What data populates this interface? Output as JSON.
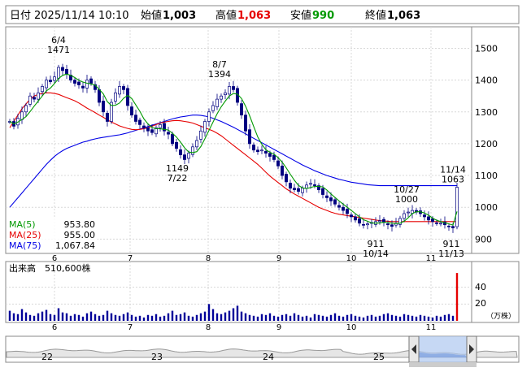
{
  "header": {
    "date_label": "日付",
    "datetime": "2025/11/14 10:10",
    "open_label": "始値",
    "open_value": "1,003",
    "high_label": "高値",
    "high_value": "1,063",
    "low_label": "安値",
    "low_value": "990",
    "close_label": "終値",
    "close_value": "1,063"
  },
  "colors": {
    "high": "#e60000",
    "low": "#009900",
    "ma5": "#009900",
    "ma25": "#e60000",
    "ma75": "#0000e6",
    "up_candle": "#ffffff",
    "down_candle": "#00007f",
    "volume": "#000099",
    "volume_last": "#e60000",
    "navigator_fill": "#aec8f0"
  },
  "legend": [
    {
      "label": "MA(5)",
      "value": "953.80",
      "color": "#009900"
    },
    {
      "label": "MA(25)",
      "value": "955.00",
      "color": "#e60000"
    },
    {
      "label": "MA(75)",
      "value": "1,067.84",
      "color": "#0000e6"
    }
  ],
  "volume_panel": {
    "title": "出来高",
    "value": "510,600株",
    "unit": "（万株）",
    "ticks": [
      "40",
      "20"
    ]
  },
  "navigator": {
    "labels": [
      "22",
      "23",
      "24",
      "25"
    ]
  },
  "chart_data": {
    "type": "candlestick",
    "y_range": [
      860,
      1560
    ],
    "y_ticks": [
      900,
      1000,
      1100,
      1200,
      1300,
      1400,
      1500
    ],
    "x_ticks": [
      "6",
      "7",
      "8",
      "9",
      "10",
      "11"
    ],
    "annotations": [
      {
        "date": "6/4",
        "value": 1471,
        "position": "above"
      },
      {
        "date": "8/7",
        "value": 1394,
        "position": "above"
      },
      {
        "date": "7/22",
        "value": 1149,
        "position": "below"
      },
      {
        "date": "10/27",
        "value": 1000,
        "position": "above"
      },
      {
        "date": "10/14",
        "value": 911,
        "position": "below"
      },
      {
        "date": "11/14",
        "value": 1063,
        "position": "above"
      },
      {
        "date": "11/13",
        "value": 911,
        "position": "below"
      }
    ],
    "close_series": [
      1270,
      1255,
      1280,
      1300,
      1320,
      1350,
      1340,
      1360,
      1380,
      1400,
      1395,
      1410,
      1440,
      1430,
      1420,
      1400,
      1390,
      1385,
      1375,
      1400,
      1390,
      1370,
      1330,
      1300,
      1270,
      1330,
      1360,
      1380,
      1370,
      1320,
      1290,
      1270,
      1260,
      1250,
      1240,
      1235,
      1250,
      1260,
      1240,
      1230,
      1200,
      1185,
      1165,
      1150,
      1170,
      1190,
      1210,
      1240,
      1270,
      1300,
      1320,
      1340,
      1350,
      1360,
      1380,
      1370,
      1330,
      1290,
      1240,
      1200,
      1180,
      1175,
      1180,
      1170,
      1160,
      1150,
      1130,
      1100,
      1080,
      1060,
      1055,
      1050,
      1060,
      1070,
      1075,
      1068,
      1055,
      1040,
      1030,
      1020,
      1010,
      1000,
      990,
      980,
      970,
      960,
      950,
      945,
      948,
      950,
      955,
      958,
      952,
      945,
      940,
      950,
      965,
      980,
      985,
      990,
      985,
      980,
      970,
      960,
      955,
      950,
      950,
      945,
      940,
      935,
      1063
    ],
    "ma5_series": [
      1270,
      1262,
      1268,
      1276,
      1285,
      1301,
      1318,
      1334,
      1350,
      1366,
      1375,
      1389,
      1405,
      1415,
      1419,
      1415,
      1408,
      1399,
      1394,
      1390,
      1388,
      1384,
      1371,
      1357,
      1332,
      1320,
      1321,
      1328,
      1343,
      1352,
      1342,
      1322,
      1302,
      1278,
      1262,
      1251,
      1247,
      1247,
      1245,
      1243,
      1233,
      1221,
      1205,
      1187,
      1174,
      1172,
      1175,
      1191,
      1216,
      1242,
      1268,
      1294,
      1316,
      1334,
      1350,
      1358,
      1356,
      1342,
      1318,
      1288,
      1254,
      1221,
      1198,
      1181,
      1173,
      1167,
      1156,
      1142,
      1124,
      1104,
      1085,
      1069,
      1061,
      1059,
      1062,
      1066,
      1066,
      1064,
      1054,
      1042,
      1031,
      1020,
      1010,
      1000,
      990,
      980,
      970,
      961,
      956,
      951,
      950,
      951,
      953,
      952,
      950,
      949,
      950,
      956,
      967,
      980,
      986,
      986,
      982,
      975,
      966,
      959,
      955,
      951,
      948,
      944,
      987
    ],
    "ma25_series": [
      1250,
      1270,
      1290,
      1310,
      1325,
      1340,
      1350,
      1355,
      1358,
      1360,
      1360,
      1358,
      1355,
      1350,
      1345,
      1340,
      1335,
      1328,
      1320,
      1312,
      1305,
      1298,
      1290,
      1283,
      1275,
      1268,
      1262,
      1256,
      1252,
      1248,
      1245,
      1244,
      1245,
      1247,
      1250,
      1255,
      1260,
      1265,
      1268,
      1270,
      1272,
      1273,
      1272,
      1270,
      1268,
      1265,
      1260,
      1255,
      1250,
      1245,
      1240,
      1233,
      1225,
      1215,
      1205,
      1195,
      1185,
      1175,
      1165,
      1155,
      1145,
      1135,
      1123,
      1110,
      1098,
      1088,
      1078,
      1068,
      1058,
      1050,
      1042,
      1035,
      1028,
      1021,
      1014,
      1007,
      1000,
      995,
      990,
      985,
      981,
      978,
      976,
      974,
      972,
      970,
      968,
      966,
      964,
      962,
      960,
      958,
      957,
      956,
      955,
      955,
      955,
      955,
      955,
      955,
      955,
      955,
      955,
      955,
      955,
      955,
      955,
      955,
      955,
      955,
      955
    ],
    "ma75_series": [
      1000,
      1015,
      1030,
      1045,
      1060,
      1075,
      1090,
      1105,
      1120,
      1135,
      1148,
      1160,
      1170,
      1178,
      1185,
      1190,
      1195,
      1200,
      1205,
      1208,
      1212,
      1215,
      1218,
      1220,
      1222,
      1224,
      1226,
      1228,
      1231,
      1234,
      1238,
      1242,
      1246,
      1250,
      1254,
      1258,
      1262,
      1266,
      1270,
      1274,
      1278,
      1281,
      1284,
      1286,
      1288,
      1290,
      1290,
      1289,
      1287,
      1284,
      1280,
      1275,
      1270,
      1264,
      1258,
      1252,
      1245,
      1238,
      1231,
      1224,
      1217,
      1210,
      1203,
      1196,
      1189,
      1182,
      1175,
      1168,
      1161,
      1154,
      1147,
      1140,
      1133,
      1127,
      1121,
      1115,
      1110,
      1105,
      1100,
      1096,
      1092,
      1088,
      1085,
      1082,
      1079,
      1077,
      1075,
      1073,
      1071,
      1070,
      1069,
      1068,
      1068,
      1068,
      1068,
      1068,
      1068,
      1068,
      1068,
      1068,
      1068,
      1068,
      1068,
      1068,
      1068,
      1068,
      1068,
      1068,
      1068,
      1068,
      1068
    ],
    "volume_series": [
      12,
      9,
      8,
      14,
      10,
      7,
      6,
      9,
      11,
      13,
      8,
      7,
      15,
      10,
      9,
      6,
      8,
      7,
      5,
      9,
      11,
      8,
      6,
      7,
      12,
      9,
      7,
      6,
      8,
      10,
      7,
      5,
      6,
      4,
      7,
      6,
      8,
      5,
      6,
      9,
      12,
      7,
      8,
      10,
      6,
      5,
      7,
      9,
      11,
      20,
      14,
      9,
      8,
      10,
      12,
      15,
      18,
      11,
      9,
      7,
      6,
      5,
      8,
      7,
      9,
      6,
      5,
      7,
      8,
      6,
      9,
      7,
      5,
      6,
      4,
      8,
      7,
      6,
      5,
      7,
      9,
      6,
      5,
      7,
      8,
      6,
      5,
      4,
      6,
      7,
      5,
      6,
      8,
      9,
      7,
      6,
      5,
      8,
      7,
      6,
      5,
      7,
      6,
      5,
      4,
      6,
      5,
      7,
      8,
      6,
      57
    ]
  }
}
